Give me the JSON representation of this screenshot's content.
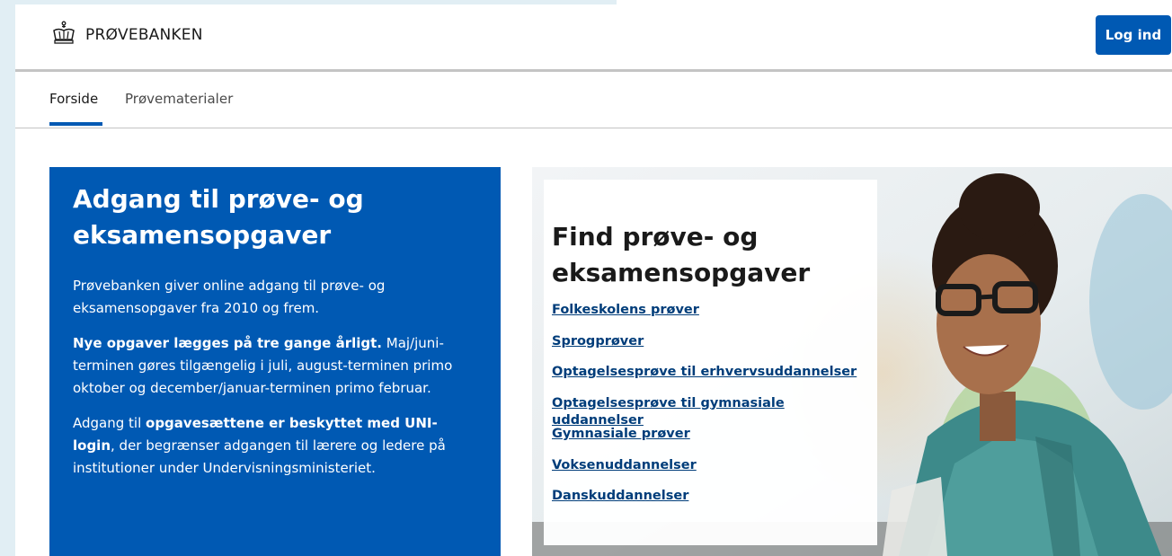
{
  "header": {
    "logo_text": "PRØVEBANKEN",
    "logo_icon": "crown-icon",
    "login_label": "Log ind"
  },
  "nav": {
    "items": [
      {
        "label": "Forside",
        "active": true
      },
      {
        "label": "Prøvematerialer",
        "active": false
      }
    ]
  },
  "hero": {
    "title_line1": "Adgang til prøve- og",
    "title_line2": "eksamensopgaver",
    "p1": "Prøvebanken giver online adgang til prøve- og eksamensopgaver fra 2010 og frem.",
    "p2_bold": "Nye opgaver lægges på tre gange årligt.",
    "p2_rest": " Maj/juni-terminen gøres tilgængelig i juli, august-terminen primo oktober og december/januar-terminen primo februar.",
    "p3_pre": "Adgang til ",
    "p3_bold": "opgavesættene er beskyttet med UNI-login",
    "p3_post": ", der begrænser adgangen til lærere og ledere på institutioner under Undervisningsministeriet."
  },
  "find": {
    "title_line1": "Find prøve- og",
    "title_line2": "eksamensopgaver",
    "links": [
      "Folkeskolens prøver",
      "Sprogprøver",
      "Optagelsesprøve til erhvervsuddannelser",
      "Optagelsesprøve til gymnasiale uddannelser",
      "Gymnasiale prøver",
      "Voksenuddannelser",
      "Danskuddannelser"
    ]
  },
  "colors": {
    "brand_blue": "#0059b3",
    "link_blue": "#003d7a",
    "strip": "#e1eef4"
  }
}
